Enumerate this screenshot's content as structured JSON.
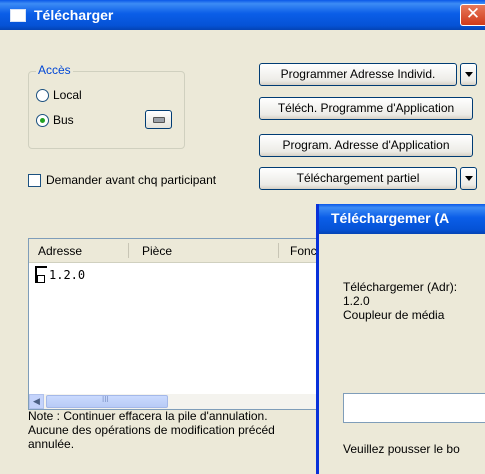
{
  "window": {
    "title": "Télécharger",
    "close_glyph": "✕"
  },
  "access_group": {
    "title": "Accès",
    "options": [
      {
        "label": "Local",
        "selected": false
      },
      {
        "label": "Bus",
        "selected": true
      }
    ],
    "settings_icon": "keyboard-icon"
  },
  "ask_each_participant": {
    "label": "Demander avant chq participant",
    "checked": false
  },
  "buttons": {
    "program_individual_address": "Programmer Adresse  Individ.",
    "download_app_program": "Téléch. Programme d'Application",
    "program_app_address": "Program. Adresse d'Application",
    "partial_download": "Téléchargement partiel"
  },
  "device_list": {
    "columns": [
      "Adresse",
      "Pièce",
      "Fonc"
    ],
    "rows": [
      {
        "address": "1.2.0",
        "icon": "device-icon"
      }
    ],
    "scroll_thumb_label": "III"
  },
  "note": {
    "lines": [
      "Note : Continuer effacera la pile d'annulation.",
      "Aucune des opérations de modification précéd",
      "annulée."
    ]
  },
  "progress_dialog": {
    "title": "Téléchargemer (A",
    "lines": [
      "Téléchargemer (Adr):",
      "1.2.0",
      "Coupleur de média"
    ],
    "footer": "Veuillez pousser le bo",
    "input_value": ""
  },
  "colors": {
    "titlebar": "#0552d6",
    "window_bg": "#ece9d8",
    "group_title": "#0046d5",
    "close_button": "#cf3a1a",
    "radio_dot": "#21a121"
  }
}
